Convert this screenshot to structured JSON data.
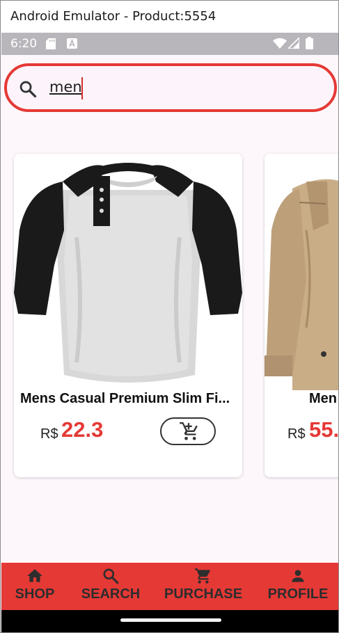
{
  "window": {
    "title": "Android Emulator - Product:5554"
  },
  "status_bar": {
    "time": "6:20",
    "icons": [
      "sd-card-icon",
      "a-notification-icon",
      "wifi-icon",
      "signal-icon",
      "battery-icon"
    ]
  },
  "search": {
    "value": "men",
    "icon": "search-icon"
  },
  "products": [
    {
      "name": "Mens Casual Premium Slim Fi...",
      "currency": "R$",
      "price": "22.3",
      "image": "raglan-henley-shirt"
    },
    {
      "name": "Men",
      "currency": "R$",
      "price": "55.",
      "image": "khaki-jacket"
    }
  ],
  "nav": {
    "items": [
      {
        "label": "SHOP",
        "icon": "home-icon"
      },
      {
        "label": "SEARCH",
        "icon": "search-icon"
      },
      {
        "label": "PURCHASE",
        "icon": "cart-icon"
      },
      {
        "label": "PROFILE",
        "icon": "person-icon"
      }
    ]
  },
  "colors": {
    "accent": "#e53935",
    "background": "#fdf7fc",
    "statusbar": "#b9b6bb"
  }
}
